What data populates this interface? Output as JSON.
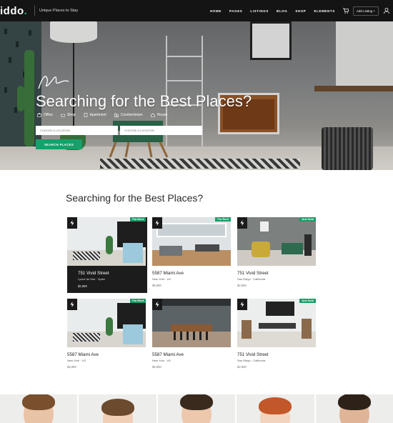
{
  "nav": {
    "logo": "iddo",
    "logo_dot": ".",
    "tagline": "Unique Places to Stay",
    "menu": [
      "HOME",
      "PAGES",
      "LISTINGS",
      "BLOG",
      "SHOP",
      "ELEMENTS"
    ],
    "add_listing": "Add Listing +",
    "icons": [
      "cart-icon",
      "user-icon"
    ]
  },
  "hero": {
    "title": "Searching for the Best Places?",
    "categories": [
      {
        "label": "Office",
        "icon": "office-icon"
      },
      {
        "label": "Shop",
        "icon": "shop-icon"
      },
      {
        "label": "Apartment",
        "icon": "apartment-icon"
      },
      {
        "label": "Condominium",
        "icon": "condominium-icon"
      },
      {
        "label": "House",
        "icon": "house-icon"
      }
    ],
    "location_placeholder": "CHOOSE A LOCATION",
    "category_placeholder": "CHOOSE A LOCATION",
    "search_button": "SEARCH PLACES"
  },
  "section": {
    "title": "Searching for the Best Places?"
  },
  "listings": [
    {
      "name": "751 Vivid Street",
      "location": "Lyoné de Mar · Spain",
      "price": "$2,990",
      "badge": "For Rent",
      "featured": true
    },
    {
      "name": "5587 Miami Ave",
      "location": "New York · US",
      "price": "$5,990",
      "badge": "For Rent",
      "featured": false
    },
    {
      "name": "751 Vivid Street",
      "location": "San Diego · California",
      "price": "$2,990",
      "badge": "Just Sold",
      "featured": false
    },
    {
      "name": "5587 Miami Ave",
      "location": "New York · US",
      "price": "$5,990",
      "badge": "For Rent",
      "featured": false
    },
    {
      "name": "5587 Miami Ave",
      "location": "New York · US",
      "price": "$5,990",
      "badge": "",
      "featured": false
    },
    {
      "name": "751 Vivid Street",
      "location": "San Diego · California",
      "price": "$2,990",
      "badge": "Just Sold",
      "featured": false
    }
  ],
  "colors": {
    "accent": "#17a06b",
    "nav_bg": "#141414",
    "featured_bg": "#1c1c1c"
  }
}
